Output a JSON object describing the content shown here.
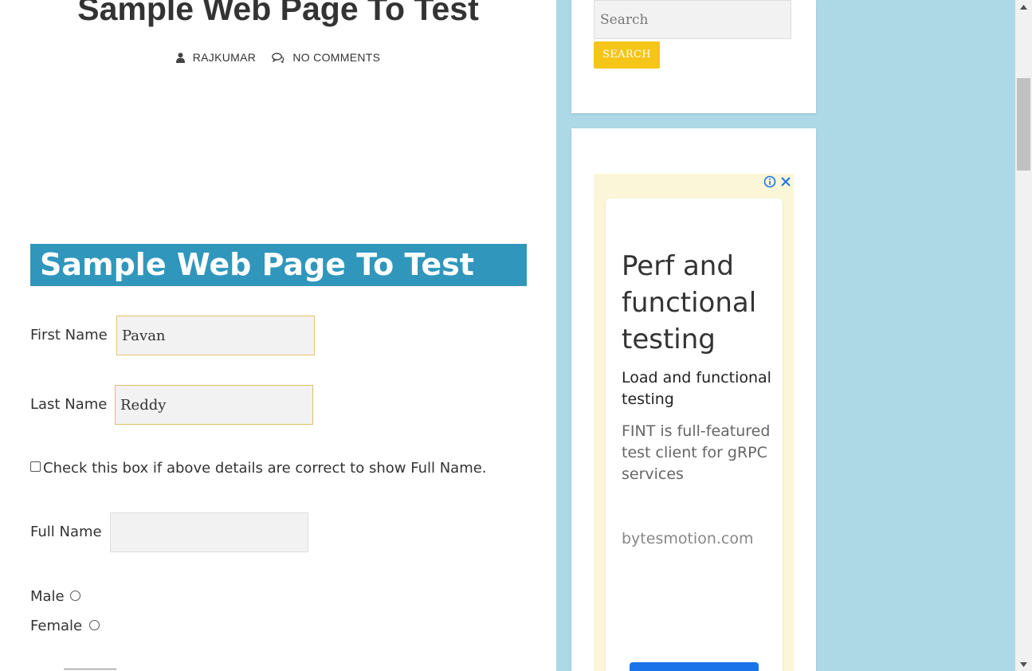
{
  "post": {
    "title": "Sample Web Page To Test",
    "author": "RAJKUMAR",
    "comments": "NO COMMENTS"
  },
  "form": {
    "banner": "Sample Web Page To Test",
    "first_name_label": "First Name",
    "first_name_value": "Pavan",
    "last_name_label": "Last Name",
    "last_name_value": "Reddy",
    "checkbox_label": "Check this box if above details are correct to show Full Name.",
    "checkbox_checked": false,
    "full_name_label": "Full Name",
    "full_name_value": "",
    "gender_options": [
      "Male",
      "Female"
    ]
  },
  "sidebar": {
    "search_placeholder": "Search",
    "search_button": "SEARCH",
    "ad": {
      "headline": "Perf and functional testing",
      "subheadline": "Load and functional testing",
      "description": "FINT is full-featured test client for gRPC services",
      "domain": "bytesmotion.com"
    }
  },
  "colors": {
    "page_background": "#add8e6",
    "banner_background": "#3096bc",
    "search_button": "#f5c518",
    "input_border_focus": "#e6c56a"
  },
  "icons": [
    "user-icon",
    "comments-icon",
    "ad-info-icon",
    "ad-close-icon",
    "scroll-up-icon",
    "scroll-down-icon"
  ]
}
